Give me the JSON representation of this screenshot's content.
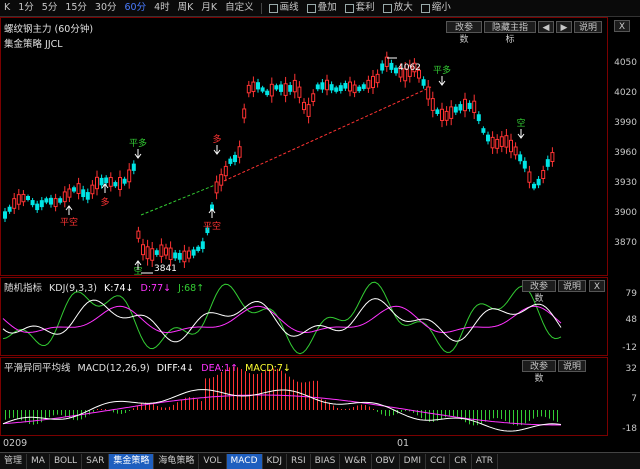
{
  "toolbar": {
    "items": [
      "K",
      "1分",
      "5分",
      "15分",
      "30分",
      "60分",
      "4时",
      "周K",
      "月K",
      "自定义"
    ],
    "active": "60分",
    "tools": [
      "画线",
      "叠加",
      "套利",
      "放大",
      "缩小"
    ]
  },
  "main_panel": {
    "title": "螺纹钢主力 (60分钟)",
    "subtitle": "集金策略 JJCL",
    "buttons": [
      "改参数",
      "隐藏主指标",
      "说明"
    ],
    "arrows": [
      "◀",
      "▶"
    ],
    "close": "X",
    "y_ticks": [
      "4050",
      "4020",
      "3990",
      "3960",
      "3930",
      "3900",
      "3870"
    ],
    "annotations": {
      "high": "4062",
      "low": "3841",
      "ping_duo_1": "平多",
      "ping_duo_2": "平多",
      "duo_1": "多",
      "duo_2": "多",
      "kong_1": "空",
      "kong_2": "空",
      "ping_kong_1": "平空",
      "ping_kong_2": "平空"
    }
  },
  "kdj_panel": {
    "title": "随机指标",
    "params": "KDJ(9,3,3)",
    "k": "K:74↓",
    "d": "D:77↓",
    "j": "J:68↑",
    "buttons": [
      "改参数",
      "说明"
    ],
    "close": "X",
    "y_ticks": [
      "79",
      "48",
      "-12"
    ]
  },
  "macd_panel": {
    "title": "平滑异同平均线",
    "params": "MACD(12,26,9)",
    "diff": "DIFF:4↓",
    "dea": "DEA:1↑",
    "macd": "MACD:7↓",
    "buttons": [
      "改参数",
      "说明"
    ],
    "close": "X",
    "y_ticks": [
      "32",
      "7",
      "-18"
    ]
  },
  "time_axis": {
    "left": "0209",
    "mid": "01"
  },
  "bottom_tabs": [
    "管理",
    "MA",
    "BOLL",
    "SAR",
    "集金策略",
    "海龟策略",
    "VOL",
    "MACD",
    "KDJ",
    "RSI",
    "BIAS",
    "W&R",
    "OBV",
    "DMI",
    "CCI",
    "CR",
    "ATR"
  ],
  "active_tabs": [
    "集金策略",
    "MACD"
  ],
  "colors": {
    "up": "#ff3333",
    "down": "#00e5e5",
    "k_line": "#ffffff",
    "d_line": "#ff33ff",
    "j_line": "#33cc33",
    "trend_up": "#33cc33",
    "trend_red": "#ff3333",
    "active_tab": "#1f5fbf",
    "frame": "#7a0000"
  }
}
